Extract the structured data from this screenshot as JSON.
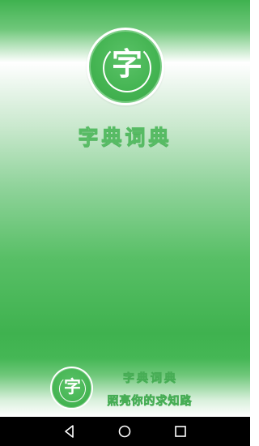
{
  "splash": {
    "logo_char": "字",
    "app_title": "字典词典",
    "footer_logo_char": "字",
    "footer_title": "字典词典",
    "footer_slogan": "照亮你的求知路"
  },
  "navbar": {
    "back_icon": "back-triangle-icon",
    "home_icon": "home-circle-icon",
    "recent_icon": "recent-square-icon"
  },
  "colors": {
    "brand_green": "#3fb24f",
    "white": "#ffffff",
    "navbar": "#000000"
  }
}
